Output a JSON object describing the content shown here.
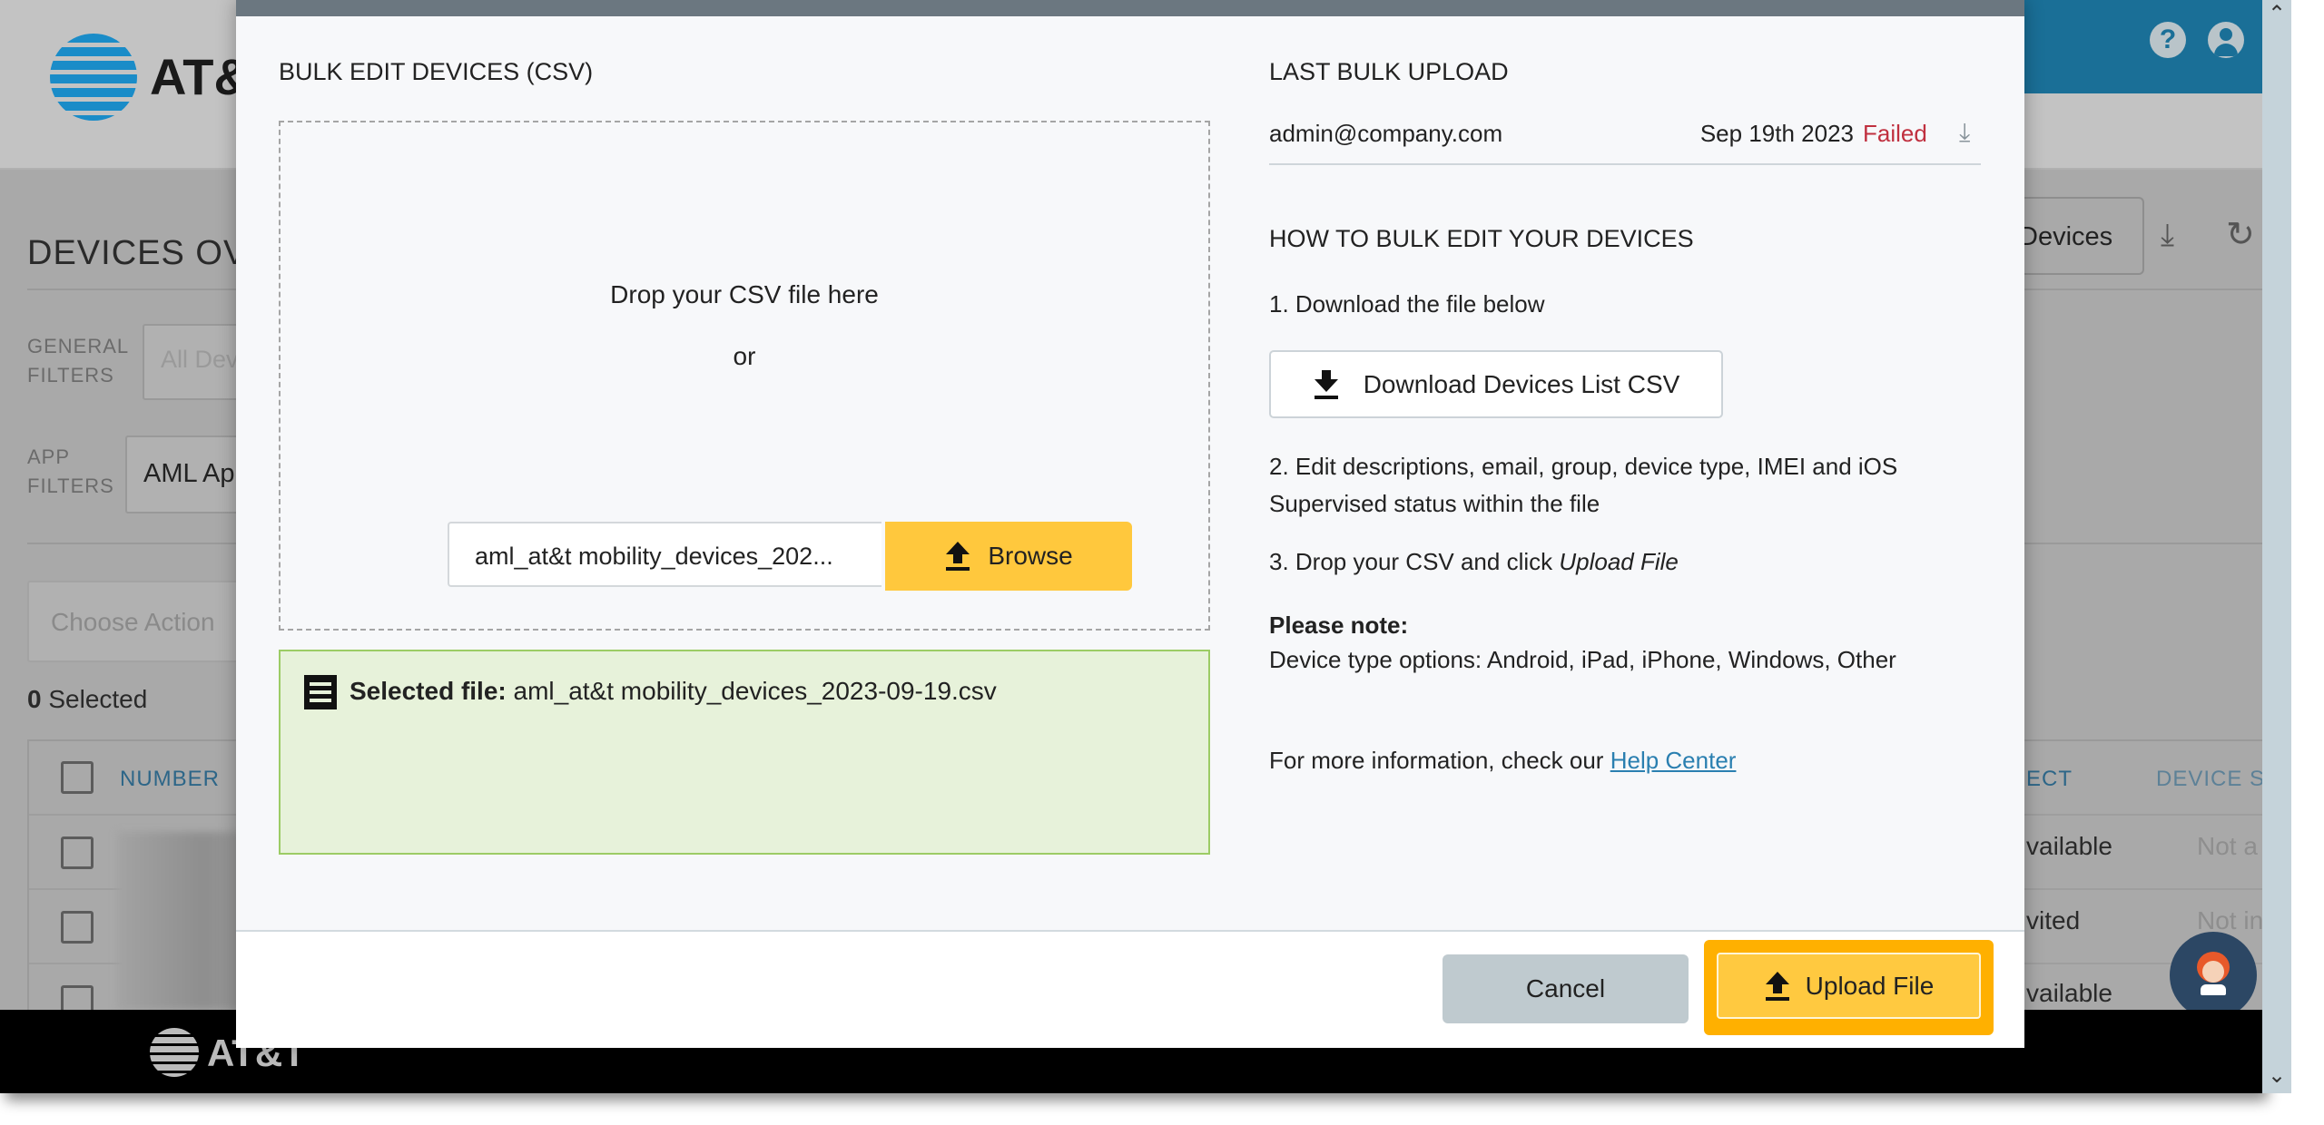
{
  "background_app": {
    "brand": "AT&T",
    "brand_visible": "AT&",
    "page_title": "DEVICES OVER",
    "general_filters_label": [
      "GENERAL",
      "FILTERS"
    ],
    "general_filter_value": "All Dev",
    "app_filters_label": [
      "APP",
      "FILTERS"
    ],
    "app_filter_value": "AML Ap",
    "choose_action_placeholder": "Choose Action",
    "selected_count": "0",
    "selected_label": "Selected",
    "devices_button": "Devices",
    "table": {
      "headers": [
        "NUMBER",
        "ECT",
        "DEVICE SE"
      ],
      "rows": [
        {
          "col2": "vailable",
          "col3": "Not a"
        },
        {
          "col2": "vited",
          "col3": "Not in"
        },
        {
          "col2": "vailable",
          "col3": ""
        }
      ]
    },
    "footer_brand": "AT&T",
    "colors": {
      "header_blue": "#1a6f97",
      "link_blue": "#3a7fa3"
    }
  },
  "modal": {
    "left": {
      "title": "BULK EDIT DEVICES (CSV)",
      "drop_text": "Drop your CSV file here",
      "or_text": "or",
      "file_input_value": "aml_at&t mobility_devices_202...",
      "browse_label": "Browse",
      "selected_file_label": "Selected file:",
      "selected_file_name": "aml_at&t mobility_devices_2023-09-19.csv"
    },
    "right": {
      "last_upload_title": "LAST BULK UPLOAD",
      "last_upload": {
        "user": "admin@company.com",
        "date": "Sep 19th 2023",
        "status": "Failed",
        "status_color": "#c0303f"
      },
      "howto_title": "HOW TO BULK EDIT YOUR DEVICES",
      "step1": "1. Download the file below",
      "download_button": "Download Devices List CSV",
      "step2_line1": "2. Edit descriptions, email, group, device type, IMEI and iOS",
      "step2_line2": "Supervised status within the file",
      "step3_prefix": "3. Drop your CSV and click ",
      "step3_emphasis": "Upload File",
      "note_title": "Please note:",
      "note_text": "Device type options: Android, iPad, iPhone, Windows, Other",
      "more_info_prefix": "For more information, check our ",
      "help_link": "Help Center"
    },
    "footer": {
      "cancel_label": "Cancel",
      "upload_label": "Upload File",
      "upload_color": "#ffc940"
    }
  }
}
